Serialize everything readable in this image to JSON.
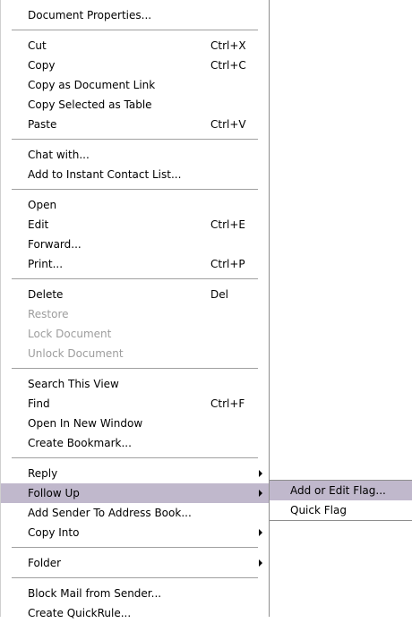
{
  "menu": {
    "groups": [
      [
        {
          "label": "Document Properties..."
        }
      ],
      [
        {
          "label": "Cut",
          "shortcut": "Ctrl+X"
        },
        {
          "label": "Copy",
          "shortcut": "Ctrl+C"
        },
        {
          "label": "Copy as Document Link"
        },
        {
          "label": "Copy Selected as Table"
        },
        {
          "label": "Paste",
          "shortcut": "Ctrl+V"
        }
      ],
      [
        {
          "label": "Chat with..."
        },
        {
          "label": "Add to Instant Contact List..."
        }
      ],
      [
        {
          "label": "Open"
        },
        {
          "label": "Edit",
          "shortcut": "Ctrl+E"
        },
        {
          "label": "Forward..."
        },
        {
          "label": "Print...",
          "shortcut": "Ctrl+P"
        }
      ],
      [
        {
          "label": "Delete",
          "shortcut": "Del"
        },
        {
          "label": "Restore",
          "disabled": true
        },
        {
          "label": "Lock Document",
          "disabled": true
        },
        {
          "label": "Unlock Document",
          "disabled": true
        }
      ],
      [
        {
          "label": "Search This View"
        },
        {
          "label": "Find",
          "shortcut": "Ctrl+F"
        },
        {
          "label": "Open In New Window"
        },
        {
          "label": "Create Bookmark..."
        }
      ],
      [
        {
          "label": "Reply",
          "submenu": true
        },
        {
          "label": "Follow Up",
          "submenu": true,
          "active": true
        },
        {
          "label": "Add Sender To Address Book..."
        },
        {
          "label": "Copy Into",
          "submenu": true
        }
      ],
      [
        {
          "label": "Folder",
          "submenu": true
        }
      ],
      [
        {
          "label": "Block Mail from Sender..."
        },
        {
          "label": "Create QuickRule..."
        }
      ]
    ]
  },
  "submenu": {
    "items": [
      {
        "label": "Add or Edit Flag...",
        "active": true
      },
      {
        "label": "Quick Flag"
      }
    ]
  },
  "colors": {
    "highlight": "#c0b8cc",
    "disabled_text": "#9d9d9d",
    "separator": "#a0a0a0"
  }
}
